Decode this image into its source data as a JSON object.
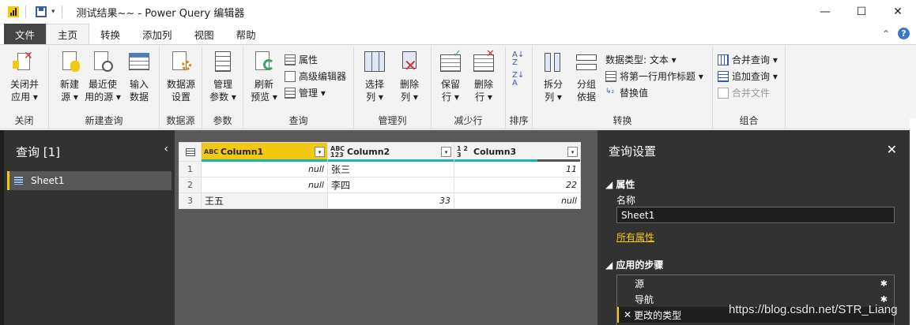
{
  "titlebar": {
    "title": "测试结果~~ - Power Query 编辑器",
    "window_buttons": [
      "—",
      "☐",
      "✕"
    ]
  },
  "tabs": [
    {
      "label": "文件"
    },
    {
      "label": "主页"
    },
    {
      "label": "转换"
    },
    {
      "label": "添加列"
    },
    {
      "label": "视图"
    },
    {
      "label": "帮助"
    }
  ],
  "tab_right": {
    "collapse": "⌃",
    "help": "?"
  },
  "ribbon": {
    "groups": {
      "close": "关闭",
      "new_query": "新建查询",
      "data_source": "数据源",
      "params": "参数",
      "query": "查询",
      "manage_cols": "管理列",
      "reduce_rows": "减少行",
      "sort": "排序",
      "transform": "转换",
      "combine": "组合"
    },
    "buttons": {
      "close_apply": [
        "关闭并",
        "应用 ▾"
      ],
      "new_source": [
        "新建",
        "源 ▾"
      ],
      "recent_sources": [
        "最近使",
        "用的源 ▾"
      ],
      "enter_data": [
        "输入",
        "数据"
      ],
      "ds_settings": [
        "数据源",
        "设置"
      ],
      "manage_params": [
        "管理",
        "参数 ▾"
      ],
      "refresh_preview": [
        "刷新",
        "预览 ▾"
      ],
      "choose_cols": [
        "选择",
        "列 ▾"
      ],
      "remove_cols": [
        "删除",
        "列 ▾"
      ],
      "keep_rows": [
        "保留",
        "行 ▾"
      ],
      "remove_rows": [
        "删除",
        "行 ▾"
      ],
      "split_col": [
        "拆分",
        "列 ▾"
      ],
      "group_by": [
        "分组",
        "依据"
      ]
    },
    "small": {
      "properties": "属性",
      "adv_editor": "高级编辑器",
      "manage": "管理 ▾",
      "data_type": "数据类型: 文本 ▾",
      "first_row_header": "将第一行用作标题 ▾",
      "replace_values": "替换值",
      "merge_queries": "合并查询 ▾",
      "append_queries": "追加查询 ▾",
      "combine_files": "合并文件"
    }
  },
  "queries": {
    "title": "查询 [1]",
    "chevron": "‹",
    "items": [
      {
        "label": "Sheet1"
      }
    ]
  },
  "grid": {
    "columns": [
      {
        "type": "ABC",
        "name": "Column1"
      },
      {
        "type": "ABC 123",
        "name": "Column2"
      },
      {
        "type": "1 2 3",
        "name": "Column3"
      }
    ],
    "dropdown": "▾",
    "rows": [
      {
        "num": "1",
        "c1": "null",
        "c2": "张三",
        "c3": "11"
      },
      {
        "num": "2",
        "c1": "null",
        "c2": "李四",
        "c3": "22"
      },
      {
        "num": "3",
        "c1": "王五",
        "c2": "33",
        "c3": "null"
      }
    ]
  },
  "settings": {
    "title": "查询设置",
    "close": "✕",
    "properties_heading": "属性",
    "name_label": "名称",
    "name_value": "Sheet1",
    "all_props_link": "所有属性",
    "steps_heading": "应用的步骤",
    "steps": [
      {
        "label": "源"
      },
      {
        "label": "导航"
      },
      {
        "label": "更改的类型"
      }
    ],
    "gear": "✱",
    "delete_step": "✕"
  },
  "watermark": "https://blog.csdn.net/STR_Liang",
  "colors": {
    "accent": "#f2c811",
    "dark_panel": "#323232",
    "grid_bg": "#595959",
    "quality_bar": "#1db3a5"
  }
}
